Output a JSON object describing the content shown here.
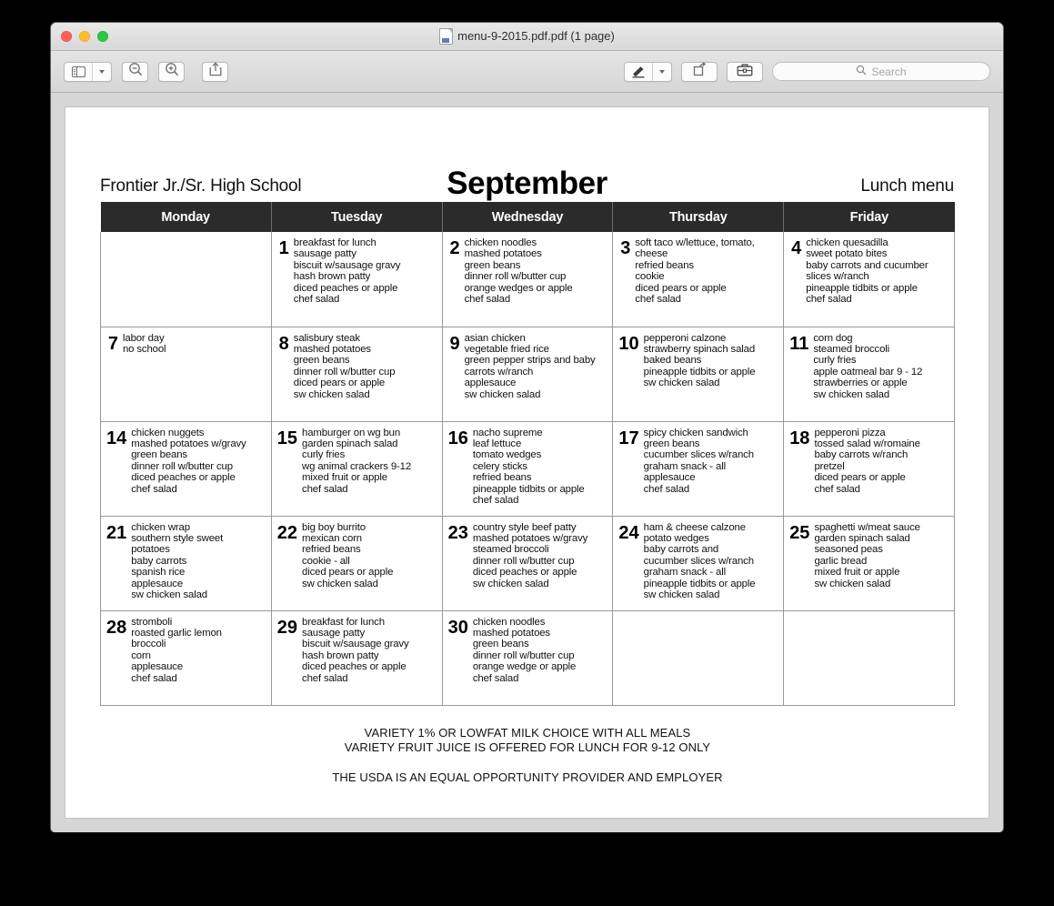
{
  "window": {
    "title": "menu-9-2015.pdf.pdf (1 page)",
    "traffic_lights": {
      "close": "#ff5f57",
      "minimize": "#ffbd2e",
      "maximize": "#28c840"
    }
  },
  "toolbar": {
    "sidebar_button": "sidebar-view",
    "zoom_out_button": "zoom-out",
    "zoom_in_button": "zoom-in",
    "share_button": "share",
    "markup_button": "markup",
    "markup_dropdown": "markup-options",
    "rotate_button": "rotate",
    "toolkit_button": "toolkit",
    "search_placeholder": "Search"
  },
  "document": {
    "school": "Frontier Jr./Sr. High School",
    "month": "September",
    "menu_label": "Lunch menu",
    "weekdays": [
      "Monday",
      "Tuesday",
      "Wednesday",
      "Thursday",
      "Friday"
    ],
    "notes": [
      "VARIETY 1% OR LOWFAT MILK CHOICE WITH ALL MEALS",
      "VARIETY FRUIT JUICE IS OFFERED FOR LUNCH FOR 9-12 ONLY"
    ],
    "usda_note": "THE USDA IS AN EQUAL OPPORTUNITY PROVIDER AND EMPLOYER",
    "weeks": [
      [
        {
          "day": "",
          "items": []
        },
        {
          "day": "1",
          "items": [
            "breakfast for lunch",
            "sausage patty",
            "biscuit w/sausage gravy",
            "hash brown patty",
            "diced peaches or apple",
            "chef salad"
          ]
        },
        {
          "day": "2",
          "items": [
            "chicken noodles",
            "mashed potatoes",
            "green beans",
            "dinner roll w/butter cup",
            "orange wedges or apple",
            "chef salad"
          ]
        },
        {
          "day": "3",
          "items": [
            "soft taco w/lettuce, tomato,",
            "cheese",
            "refried beans",
            "cookie",
            "diced pears or apple",
            "chef salad"
          ]
        },
        {
          "day": "4",
          "items": [
            "chicken quesadilla",
            "sweet potato bites",
            "baby carrots and cucumber",
            "slices w/ranch",
            "pineapple tidbits or apple",
            "chef salad"
          ]
        }
      ],
      [
        {
          "day": "7",
          "items": [
            "labor day",
            "no school"
          ]
        },
        {
          "day": "8",
          "items": [
            "salisbury steak",
            "mashed potatoes",
            "green beans",
            "dinner roll w/butter cup",
            "diced pears or apple",
            "sw chicken salad"
          ]
        },
        {
          "day": "9",
          "items": [
            "asian chicken",
            "vegetable fried rice",
            "green pepper strips and baby",
            "carrots w/ranch",
            "applesauce",
            "sw chicken salad"
          ]
        },
        {
          "day": "10",
          "items": [
            "pepperoni calzone",
            "strawberry spinach salad",
            "baked beans",
            "pineapple tidbits or apple",
            "sw chicken salad"
          ]
        },
        {
          "day": "11",
          "items": [
            "corn dog",
            "steamed broccoli",
            "curly fries",
            "apple oatmeal bar 9 - 12",
            "strawberries or apple",
            "sw chicken salad"
          ]
        }
      ],
      [
        {
          "day": "14",
          "items": [
            "chicken nuggets",
            "mashed potatoes w/gravy",
            "green beans",
            "dinner roll w/butter cup",
            "diced peaches or apple",
            "chef salad"
          ]
        },
        {
          "day": "15",
          "items": [
            "hamburger on wg bun",
            "garden spinach salad",
            "curly fries",
            "wg animal crackers 9-12",
            "mixed fruit or apple",
            "chef salad"
          ]
        },
        {
          "day": "16",
          "items": [
            "nacho supreme",
            "leaf lettuce",
            "tomato wedges",
            "celery sticks",
            "refried beans",
            "pineapple tidbits or apple",
            "chef salad"
          ]
        },
        {
          "day": "17",
          "items": [
            "spicy chicken sandwich",
            "green beans",
            "cucumber slices w/ranch",
            "graham snack - all",
            "applesauce",
            "chef salad"
          ]
        },
        {
          "day": "18",
          "items": [
            "pepperoni pizza",
            "tossed salad w/romaine",
            "baby carrots w/ranch",
            "pretzel",
            "diced pears or apple",
            "chef salad"
          ]
        }
      ],
      [
        {
          "day": "21",
          "items": [
            "chicken wrap",
            "southern style sweet",
            "potatoes",
            "baby carrots",
            "spanish rice",
            "applesauce",
            "sw chicken salad"
          ]
        },
        {
          "day": "22",
          "items": [
            "big boy burrito",
            "mexican corn",
            "refried beans",
            "cookie - all",
            "diced pears or apple",
            "sw chicken salad"
          ]
        },
        {
          "day": "23",
          "items": [
            "country style beef patty",
            "mashed potatoes w/gravy",
            "steamed broccoli",
            "dinner roll w/butter cup",
            "diced peaches or apple",
            "sw chicken salad"
          ]
        },
        {
          "day": "24",
          "items": [
            "ham & cheese calzone",
            "potato wedges",
            "baby carrots and",
            "cucumber slices w/ranch",
            "graham snack - all",
            "pineapple tidbits or apple",
            "sw chicken salad"
          ]
        },
        {
          "day": "25",
          "items": [
            "spaghetti w/meat sauce",
            "garden spinach salad",
            "seasoned peas",
            "garlic bread",
            "mixed fruit or apple",
            "sw chicken salad"
          ]
        }
      ],
      [
        {
          "day": "28",
          "items": [
            "stromboli",
            "roasted garlic lemon",
            "broccoli",
            "corn",
            "applesauce",
            "chef salad"
          ]
        },
        {
          "day": "29",
          "items": [
            "breakfast for lunch",
            "sausage patty",
            "biscuit w/sausage gravy",
            "hash brown patty",
            "diced peaches or apple",
            "chef salad"
          ]
        },
        {
          "day": "30",
          "items": [
            "chicken noodles",
            "mashed potatoes",
            "green beans",
            "dinner roll w/butter cup",
            "orange wedge or apple",
            "chef salad"
          ]
        },
        {
          "day": "",
          "items": []
        },
        {
          "day": "",
          "items": []
        }
      ]
    ]
  }
}
